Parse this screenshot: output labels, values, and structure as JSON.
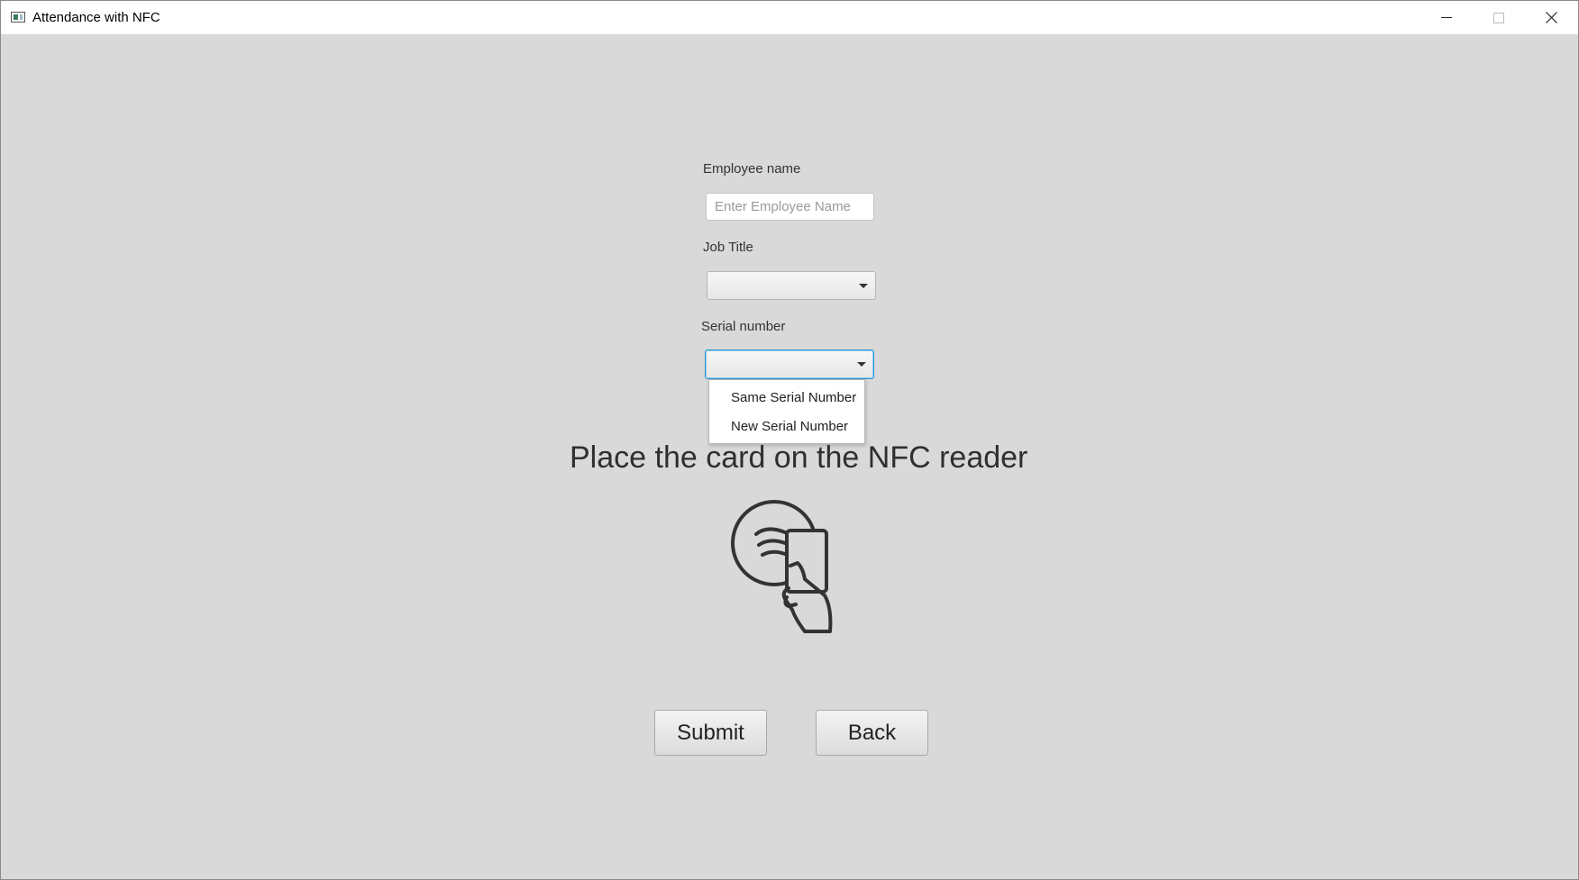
{
  "window": {
    "title": "Attendance with NFC",
    "icons": {
      "app": "app-window-icon",
      "minimize": "minimize-icon",
      "maximize": "maximize-icon",
      "close": "close-icon"
    }
  },
  "form": {
    "employee_name": {
      "label": "Employee name",
      "value": "",
      "placeholder": "Enter Employee Name"
    },
    "job_title": {
      "label": "Job Title",
      "selected": ""
    },
    "serial_number": {
      "label": "Serial number",
      "selected": "",
      "options": [
        "Same Serial Number",
        "New Serial Number"
      ]
    }
  },
  "instruction": {
    "text": "Place the card on the NFC reader",
    "icon": "nfc-tap-card-icon"
  },
  "actions": {
    "submit_label": "Submit",
    "back_label": "Back"
  },
  "colors": {
    "window_background": "#d9d9d9",
    "focus_border": "#2b95d6"
  }
}
